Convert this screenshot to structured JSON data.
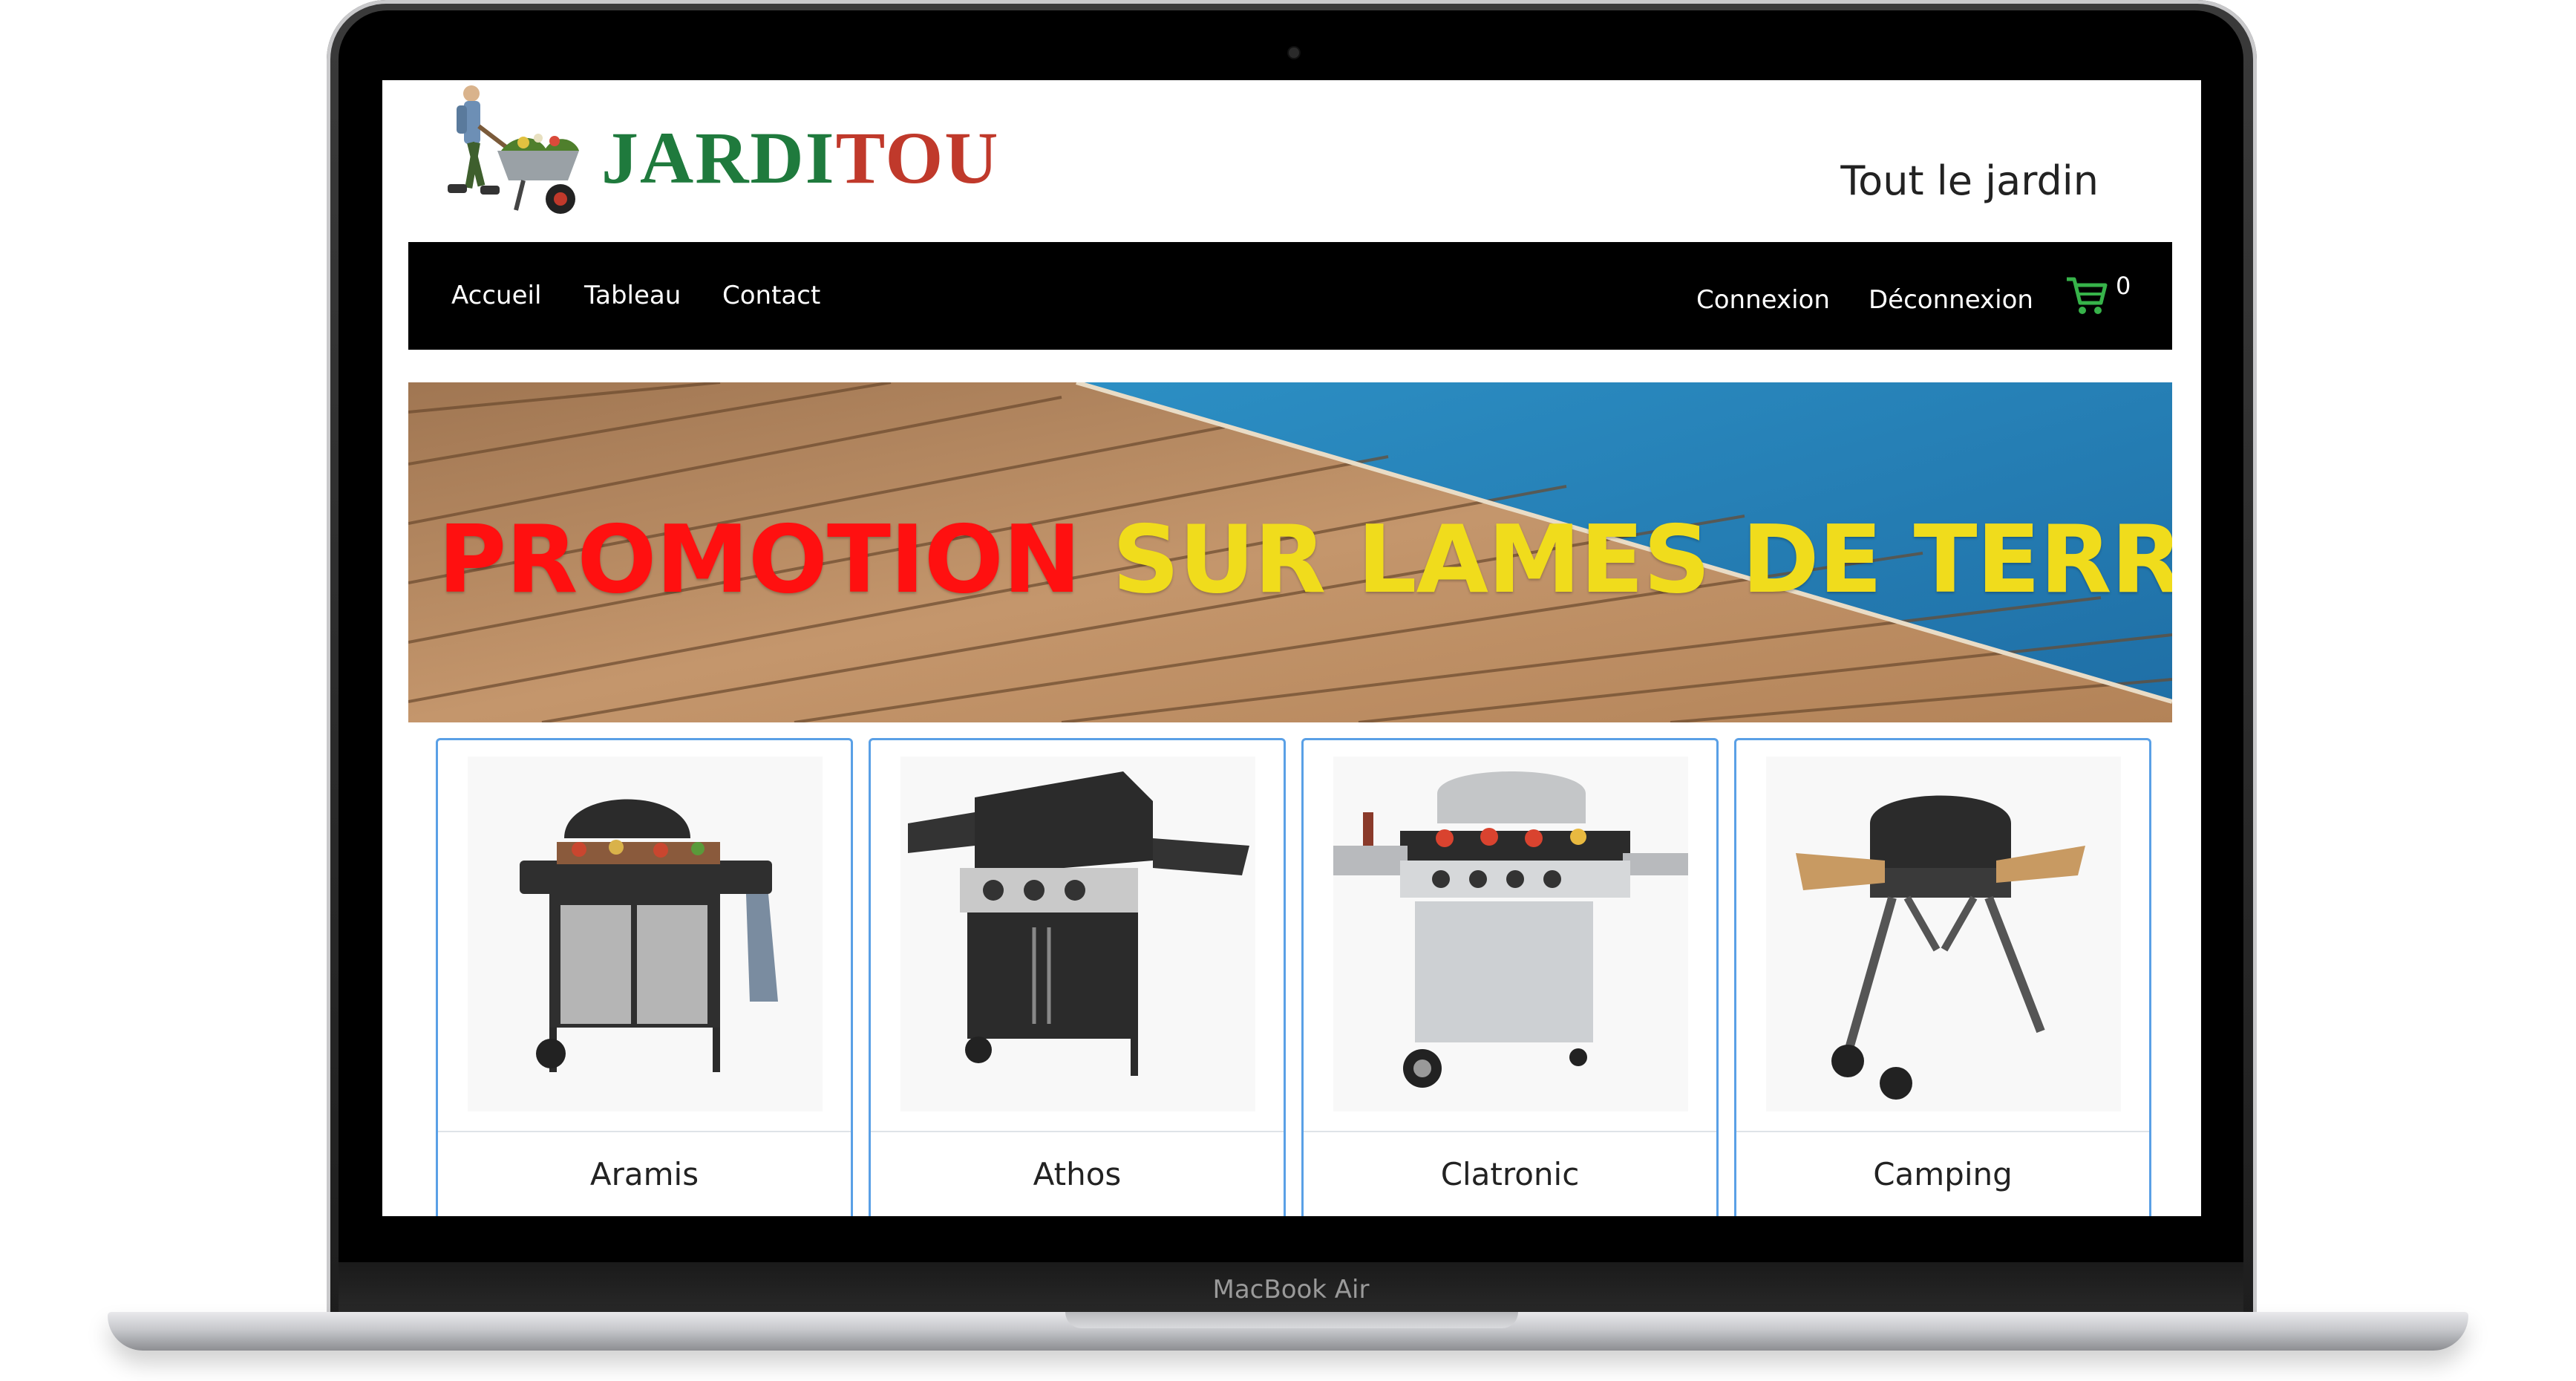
{
  "device": {
    "model_name": "MacBook Air"
  },
  "site": {
    "brand_part1": "JARDI",
    "brand_part2": "TOU",
    "tagline": "Tout le jardin"
  },
  "nav": {
    "left": [
      "Accueil",
      "Tableau",
      "Contact"
    ],
    "right": [
      "Connexion",
      "Déconnexion"
    ],
    "cart_count": "0"
  },
  "banner": {
    "text_red": "PROMOTION",
    "text_yellow": "SUR LAMES DE TERRASSE"
  },
  "products": [
    {
      "name": "Aramis",
      "icon": "gas-barbecue-image"
    },
    {
      "name": "Athos",
      "icon": "gas-barbecue-image"
    },
    {
      "name": "Clatronic",
      "icon": "gas-barbecue-image"
    },
    {
      "name": "Camping",
      "icon": "charcoal-barbecue-image"
    }
  ],
  "colors": {
    "brand_green": "#1f7a3d",
    "brand_red": "#c0392b",
    "navbar": "#000000",
    "promo_red": "#ff1010",
    "promo_yellow": "#f0dc1c",
    "card_border": "#5aa0e6",
    "cart_icon": "#37b34a"
  }
}
